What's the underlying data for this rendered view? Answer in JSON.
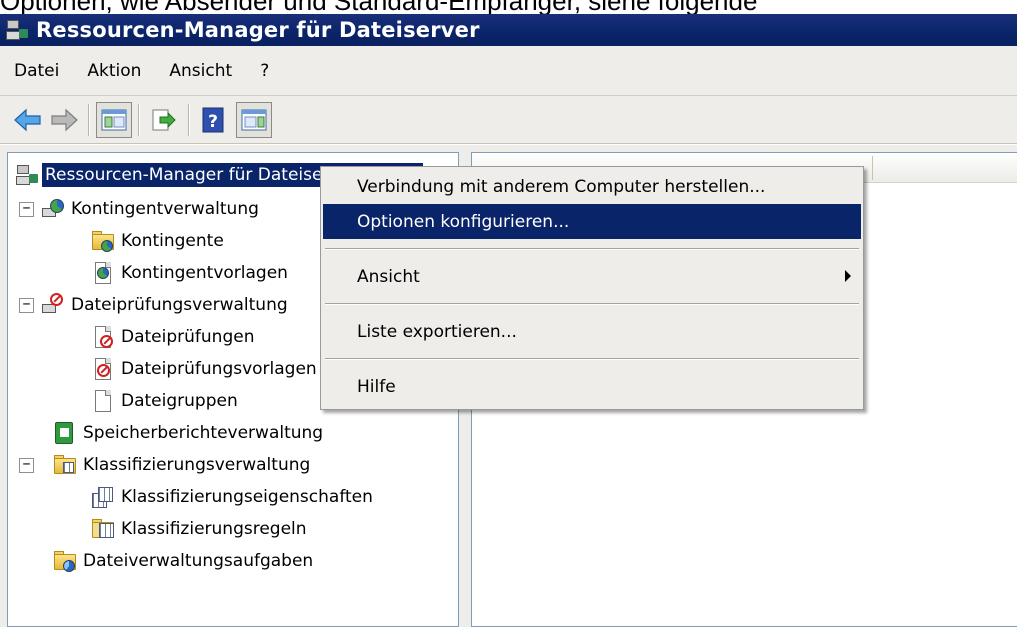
{
  "caption": "Optionen, wie Absender und Standard-Empfänger, siehe folgende",
  "window": {
    "title": "Ressourcen-Manager für Dateiserver"
  },
  "menu": [
    "Datei",
    "Aktion",
    "Ansicht",
    "?"
  ],
  "toolbar": {
    "buttons": [
      "back-arrow-icon",
      "forward-arrow-icon",
      "show-hide-console-tree-icon",
      "export-list-icon",
      "help-icon",
      "show-hide-action-pane-icon"
    ]
  },
  "tree": {
    "root": "Ressourcen-Manager für Dateiserver (Lokal)",
    "quota_mgmt": "Kontingentverwaltung",
    "quotas": "Kontingente",
    "quota_templates": "Kontingentvorlagen",
    "screen_mgmt": "Dateiprüfungsverwaltung",
    "screens": "Dateiprüfungen",
    "screen_templates": "Dateiprüfungsvorlagen",
    "file_groups": "Dateigruppen",
    "storage_reports": "Speicherberichteverwaltung",
    "class_mgmt": "Klassifizierungsverwaltung",
    "class_props": "Klassifizierungseigenschaften",
    "class_rules": "Klassifizierungsregeln",
    "file_mgmt_tasks": "Dateiverwaltungsaufgaben"
  },
  "expander_symbol": "−",
  "context_menu": {
    "connect": "Verbindung mit anderem Computer herstellen...",
    "configure": "Optionen konfigurieren...",
    "view": "Ansicht",
    "export": "Liste exportieren...",
    "help": "Hilfe"
  },
  "colors": {
    "title_bar": "#0a246a",
    "selection": "#0a246a",
    "chrome": "#efedea"
  }
}
